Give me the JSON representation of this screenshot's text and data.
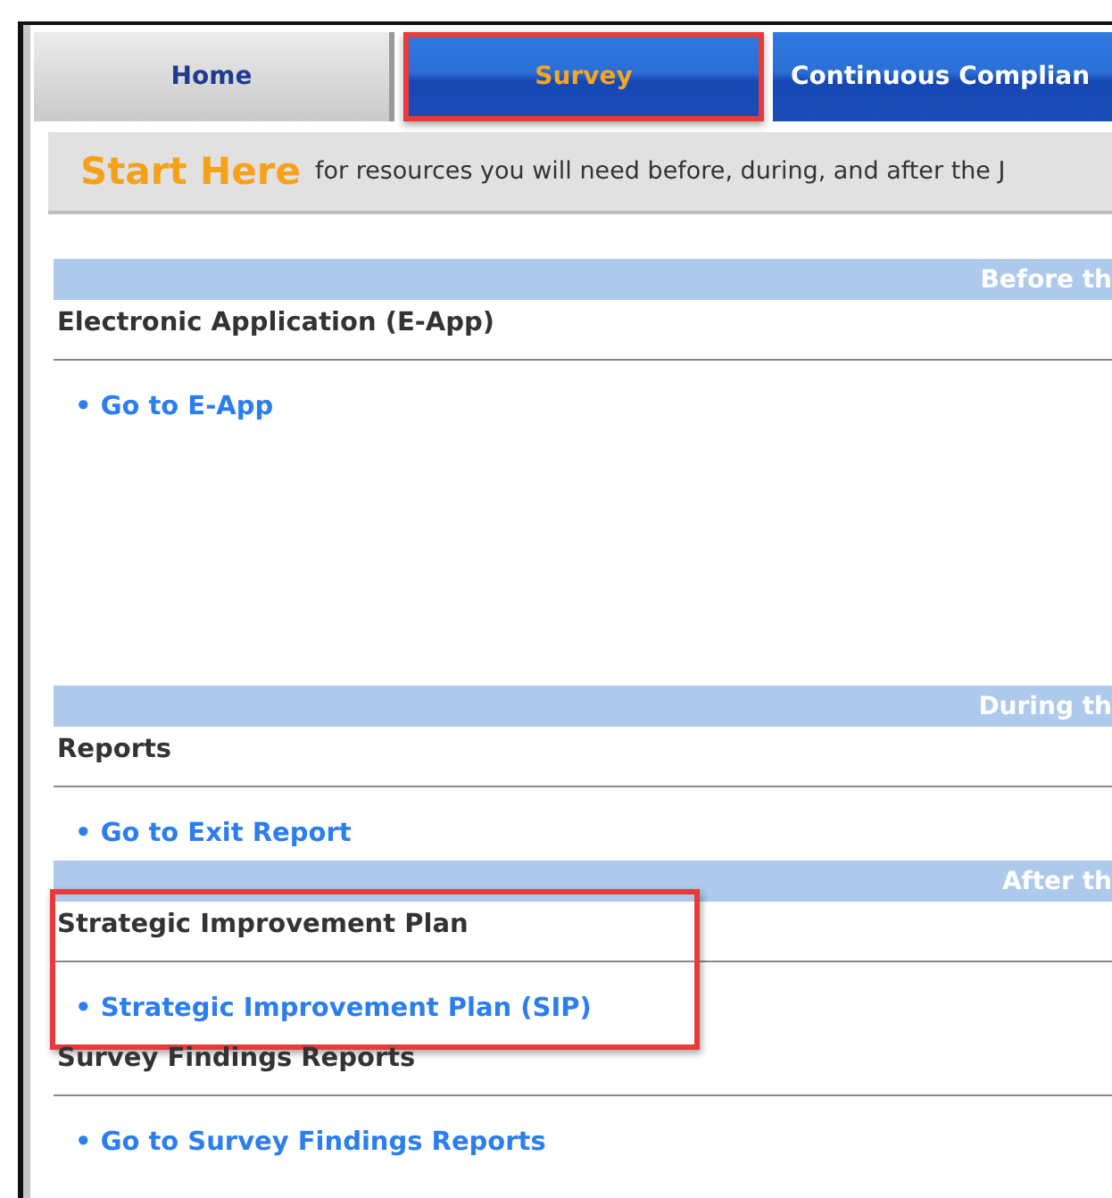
{
  "tabs": [
    {
      "label": "Home",
      "kind": "plain",
      "selected": false,
      "highlighted": false
    },
    {
      "label": "Survey",
      "kind": "primary",
      "selected": true,
      "highlighted": true
    },
    {
      "label": "Continuous Complian",
      "kind": "primary",
      "selected": false,
      "highlighted": false
    }
  ],
  "banner": {
    "title": "Start Here",
    "text": "for resources you will need before, during, and after the J"
  },
  "sections": [
    {
      "band": "Before th",
      "groups": [
        {
          "heading": "Electronic Application (E-App)",
          "highlighted": false,
          "links": [
            "• Go to E-App"
          ]
        }
      ]
    },
    {
      "band": "During th",
      "groups": [
        {
          "heading": "Reports",
          "highlighted": false,
          "links": [
            "• Go to Exit Report"
          ]
        }
      ]
    },
    {
      "band": "After th",
      "groups": [
        {
          "heading": "Strategic Improvement Plan",
          "highlighted": true,
          "links": [
            "• Strategic Improvement Plan (SIP)"
          ]
        },
        {
          "heading": "Survey Findings Reports",
          "highlighted": false,
          "links": [
            "• Go to Survey Findings Reports"
          ]
        }
      ]
    }
  ]
}
